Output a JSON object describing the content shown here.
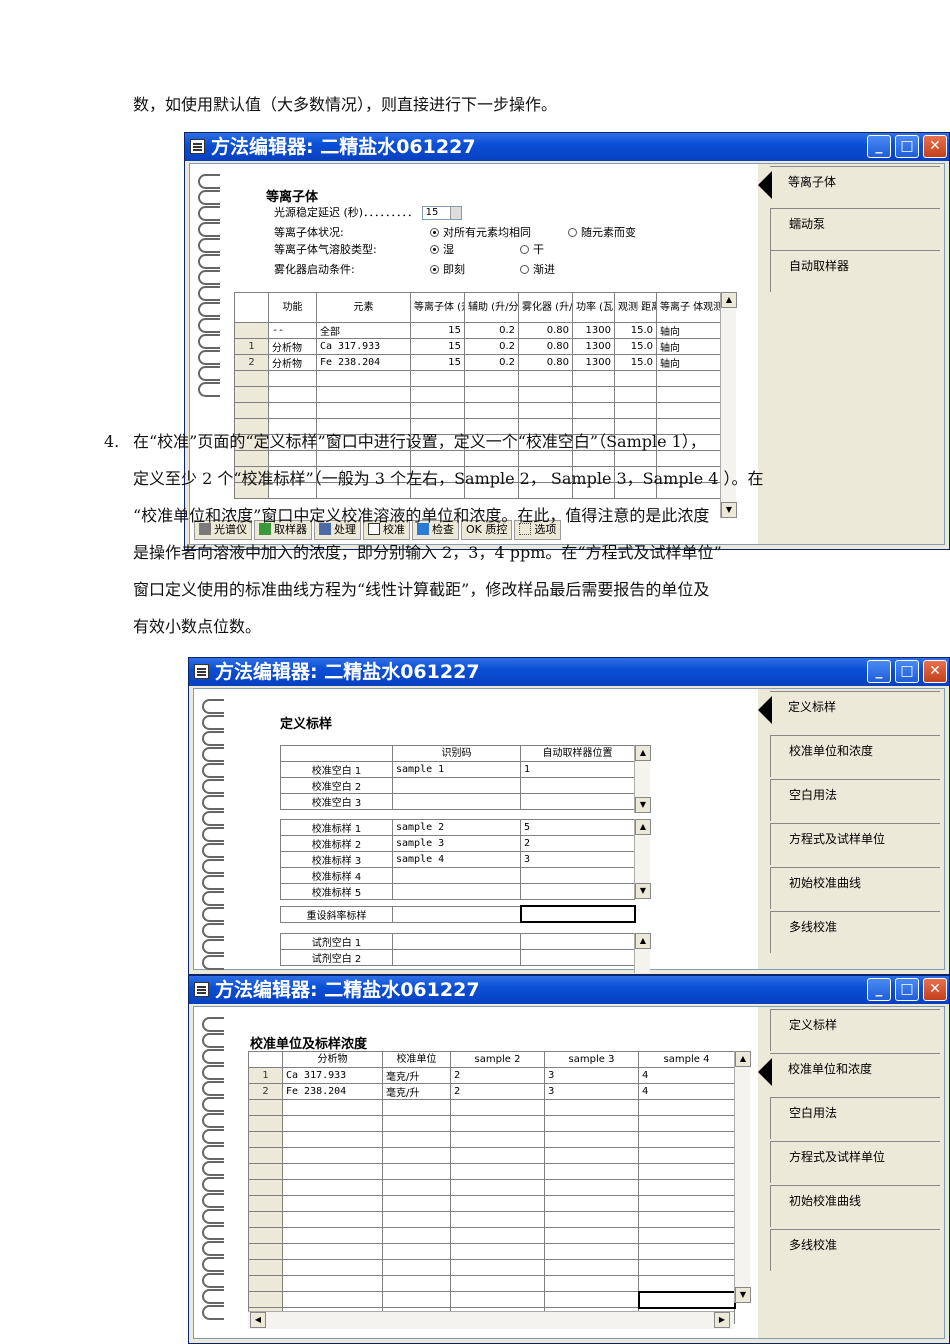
{
  "text": {
    "p1": "数，如使用默认值（大多数情况），则直接进行下一步操作。",
    "step4_num": "4.",
    "p2_l1": "在“校准”页面的“定义标样”窗口中进行设置，定义一个“校准空白”（Sample 1），",
    "p2_l2": "定义至少 2 个“校准标样”（一般为 3 个左右，Sample 2， Sample  3，Sample 4 ）。在",
    "p2_l3": "“校准单位和浓度”窗口中定义校准溶液的单位和浓度。在此，值得注意的是此浓度",
    "p2_l4": "是操作者向溶液中加入的浓度，即分别输入 2，3，4 ppm。在“方程式及试样单位”",
    "p2_l5": "窗口定义使用的标准曲线方程为“线性计算截距”，修改样品最后需要报告的单位及",
    "p2_l6": "有效小数点位数。"
  },
  "win1": {
    "title": "方法编辑器: 二精盐水061227",
    "section": "等离子体",
    "fields": [
      {
        "label": "光源稳定延迟 (秒)．．．．．．．．．",
        "value": "15"
      },
      {
        "label": "等离子体状况:",
        "opt1": "对所有元素均相同",
        "opt2": "随元素而变"
      },
      {
        "label": "等离子体气溶胶类型:",
        "opt1": "湿",
        "opt2": "干"
      },
      {
        "label": "雾化器启动条件:",
        "opt1": "即刻",
        "opt2": "渐进"
      }
    ],
    "table": {
      "headers": [
        "功能",
        "元素",
        "等离子体 (升/分)",
        "辅助 (升/分)",
        "雾化器 (升/分)",
        "功率 (瓦)",
        "观测 距离",
        "等离子 体观测"
      ],
      "rows": [
        {
          "n": "",
          "func": "--",
          "el": "全部",
          "plasma": "15",
          "aux": "0.2",
          "neb": "0.80",
          "power": "1300",
          "dist": "15.0",
          "view": "轴向"
        },
        {
          "n": "1",
          "func": "分析物",
          "el": "Ca 317.933",
          "plasma": "15",
          "aux": "0.2",
          "neb": "0.80",
          "power": "1300",
          "dist": "15.0",
          "view": "轴向"
        },
        {
          "n": "2",
          "func": "分析物",
          "el": "Fe 238.204",
          "plasma": "15",
          "aux": "0.2",
          "neb": "0.80",
          "power": "1300",
          "dist": "15.0",
          "view": "轴向"
        }
      ]
    },
    "tabs": [
      "等离子体",
      "蠕动泵",
      "自动取样器"
    ],
    "toolbar": [
      "光谱仪",
      "取样器",
      "处理",
      "校准",
      "检查",
      "OK 质控",
      "选项"
    ]
  },
  "win2": {
    "title": "方法编辑器: 二精盐水061227",
    "section": "定义标样",
    "col_headers": [
      "识别码",
      "自动取样器位置"
    ],
    "blanks": [
      {
        "name": "校准空白 1",
        "id": "sample 1",
        "pos": "1"
      },
      {
        "name": "校准空白 2",
        "id": "",
        "pos": ""
      },
      {
        "name": "校准空白 3",
        "id": "",
        "pos": ""
      }
    ],
    "stds": [
      {
        "name": "校准标样 1",
        "id": "sample 2",
        "pos": "5"
      },
      {
        "name": "校准标样 2",
        "id": "sample 3",
        "pos": "2"
      },
      {
        "name": "校准标样 3",
        "id": "sample 4",
        "pos": "3"
      },
      {
        "name": "校准标样 4",
        "id": "",
        "pos": ""
      },
      {
        "name": "校准标样 5",
        "id": "",
        "pos": ""
      }
    ],
    "reslope": "重设斜率标样",
    "reagent": [
      "试剂空白 1",
      "试剂空白 2"
    ],
    "tabs": [
      "定义标样",
      "校准单位和浓度",
      "空白用法",
      "方程式及试样单位",
      "初始校准曲线",
      "多线校准"
    ]
  },
  "win3": {
    "title": "方法编辑器: 二精盐水061227",
    "section": "校准单位及标样浓度",
    "headers": [
      "分析物",
      "校准单位",
      "sample 2",
      "sample 3",
      "sample 4"
    ],
    "rows": [
      {
        "n": "1",
        "el": "Ca 317.933",
        "unit": "毫克/升",
        "s2": "2",
        "s3": "3",
        "s4": "4"
      },
      {
        "n": "2",
        "el": "Fe 238.204",
        "unit": "毫克/升",
        "s2": "2",
        "s3": "3",
        "s4": "4"
      }
    ],
    "tabs": [
      "定义标样",
      "校准单位和浓度",
      "空白用法",
      "方程式及试样单位",
      "初始校准曲线",
      "多线校准"
    ]
  }
}
